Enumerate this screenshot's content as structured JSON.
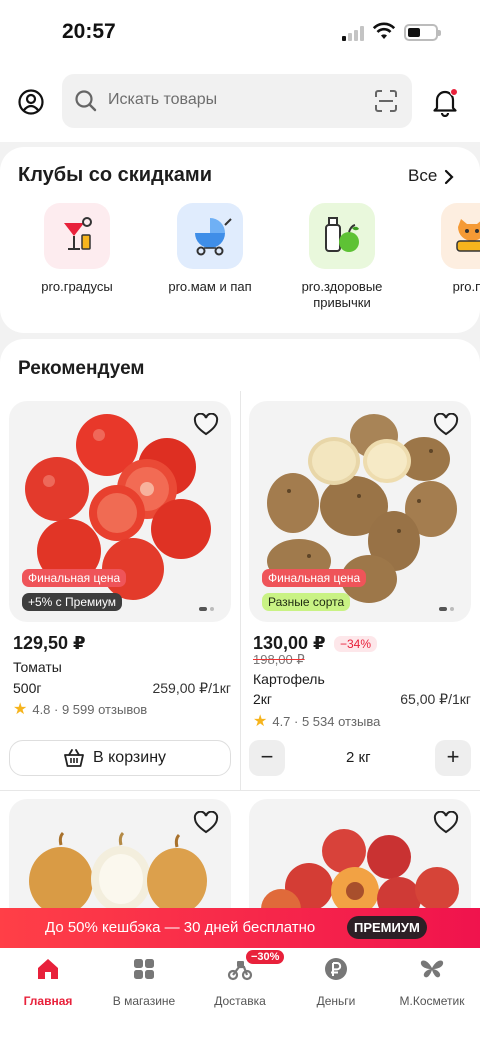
{
  "status": {
    "time": "20:57"
  },
  "search": {
    "placeholder": "Искать товары"
  },
  "clubs": {
    "title": "Клубы со скидками",
    "all_label": "Все",
    "items": [
      {
        "label": "pro.градусы",
        "icon": "cocktail-icon",
        "bg": "#fdecef"
      },
      {
        "label": "pro.мам и пап",
        "icon": "stroller-icon",
        "bg": "#e0ecfd"
      },
      {
        "label": "pro.здоровые привычки",
        "icon": "bottle-apple-icon",
        "bg": "#e9f8dc"
      },
      {
        "label": "pro.пит",
        "icon": "cat-icon",
        "bg": "#fdeee0"
      }
    ]
  },
  "recommend": {
    "title": "Рекомендуем",
    "products": [
      {
        "badge1": "Финальная цена",
        "badge2": "+5% с Премиум",
        "price": "129,50 ₽",
        "name": "Томаты",
        "weight": "500г",
        "unit_price": "259,00 ₽/1кг",
        "rating": "4.8 · 9 599 отзывов",
        "action": "В корзину"
      },
      {
        "badge1": "Финальная цена",
        "badge2": "Разные сорта",
        "price": "130,00 ₽",
        "old_price": "198,00 ₽",
        "discount": "−34%",
        "name": "Картофель",
        "weight": "2кг",
        "unit_price": "65,00 ₽/1кг",
        "rating": "4.7 · 5 534 отзыва",
        "quantity": "2 кг"
      }
    ]
  },
  "promo": {
    "text": "До 50% кешбэка — 30 дней бесплатно",
    "pill": "ПРЕМИУМ"
  },
  "nav": {
    "items": [
      {
        "label": "Главная",
        "icon": "home-icon",
        "active": true
      },
      {
        "label": "В магазине",
        "icon": "grid-icon"
      },
      {
        "label": "Доставка",
        "icon": "scooter-icon",
        "badge": "−30%"
      },
      {
        "label": "Деньги",
        "icon": "ruble-icon"
      },
      {
        "label": "М.Косметик",
        "icon": "butterfly-icon"
      }
    ]
  },
  "colors": {
    "accent": "#e8213b",
    "green_badge": "#c9f284",
    "promo": "#f0134d"
  }
}
